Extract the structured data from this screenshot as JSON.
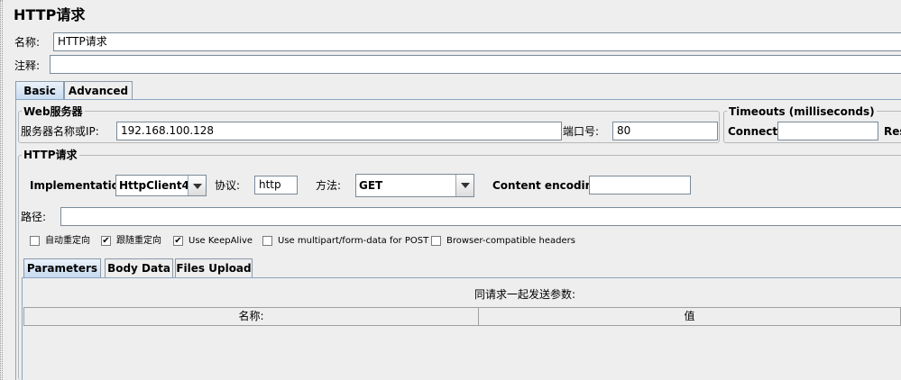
{
  "title": "HTTP请求",
  "name_label": "名称:",
  "name_value": "HTTP请求",
  "comment_label": "注释:",
  "comment_value": "",
  "main_tabs": [
    {
      "label": "Basic",
      "active": true
    },
    {
      "label": "Advanced",
      "active": false
    }
  ],
  "web_server": {
    "group_title": "Web服务器",
    "server_label": "服务器名称或IP:",
    "server_value": "192.168.100.128",
    "port_label": "端口号:",
    "port_value": "80"
  },
  "timeouts": {
    "group_title": "Timeouts (milliseconds)",
    "connect_label": "Connect:",
    "connect_value": "",
    "response_label_clipped": "Res"
  },
  "http_request": {
    "group_title": "HTTP请求",
    "implementation_label": "Implementation:",
    "implementation_value": "HttpClient4",
    "protocol_label": "协议:",
    "protocol_value": "http",
    "method_label": "方法:",
    "method_value": "GET",
    "encoding_label": "Content encoding:",
    "encoding_value": "",
    "path_label": "路径:",
    "path_value": ""
  },
  "checkboxes": [
    {
      "label": "自动重定向",
      "checked": false
    },
    {
      "label": "跟随重定向",
      "checked": true
    },
    {
      "label": "Use KeepAlive",
      "checked": true
    },
    {
      "label": "Use multipart/form-data for POST",
      "checked": false
    },
    {
      "label": "Browser-compatible headers",
      "checked": false
    }
  ],
  "param_tabs": [
    {
      "label": "Parameters",
      "active": true
    },
    {
      "label": "Body Data",
      "active": false
    },
    {
      "label": "Files Upload",
      "active": false
    }
  ],
  "params": {
    "caption": "同请求一起发送参数:",
    "columns": [
      "名称:",
      "值"
    ]
  },
  "colors": {
    "background": "#eeeeee",
    "tab_active": "#c7daf0",
    "border": "#8ca6c1"
  },
  "icons": {
    "checkmark": "check-icon",
    "dropdown": "chevron-down-icon"
  }
}
